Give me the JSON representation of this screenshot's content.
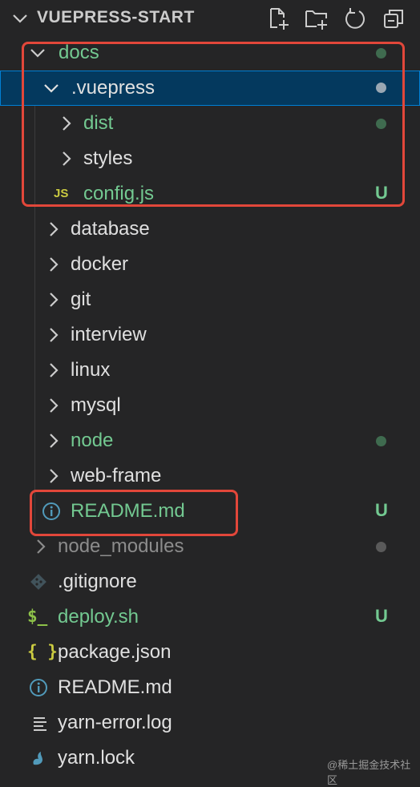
{
  "explorer": {
    "project_title": "VUEPRESS-START",
    "actions": [
      "new-file-icon",
      "new-folder-icon",
      "refresh-icon",
      "collapse-all-icon"
    ]
  },
  "tree": {
    "docs": {
      "label": "docs",
      "status": "modified-dot"
    },
    "vuepress": {
      "label": ".vuepress",
      "status": "modified-dot"
    },
    "dist": {
      "label": "dist",
      "status": "modified-dot"
    },
    "styles": {
      "label": "styles"
    },
    "config": {
      "icon_text": "JS",
      "label": "config.js",
      "status": "U"
    },
    "database": {
      "label": "database"
    },
    "docker": {
      "label": "docker"
    },
    "git": {
      "label": "git"
    },
    "interview": {
      "label": "interview"
    },
    "linux": {
      "label": "linux"
    },
    "mysql": {
      "label": "mysql"
    },
    "node": {
      "label": "node",
      "status": "modified-dot"
    },
    "webframe": {
      "label": "web-frame"
    },
    "docs_readme": {
      "label": "README.md",
      "status": "U"
    },
    "node_modules": {
      "label": "node_modules",
      "status": "ignored-dot"
    },
    "gitignore": {
      "label": ".gitignore"
    },
    "deploy": {
      "icon_text": "$_",
      "label": "deploy.sh",
      "status": "U"
    },
    "package": {
      "icon_text": "{ }",
      "label": "package.json"
    },
    "readme": {
      "label": "README.md"
    },
    "yarn_error": {
      "label": "yarn-error.log"
    },
    "yarn_lock": {
      "label": "yarn.lock"
    }
  },
  "colors": {
    "untracked": "#73c991",
    "selected_bg": "#04395e",
    "highlight": "#e2473a"
  },
  "watermark": "@稀土掘金技术社区"
}
